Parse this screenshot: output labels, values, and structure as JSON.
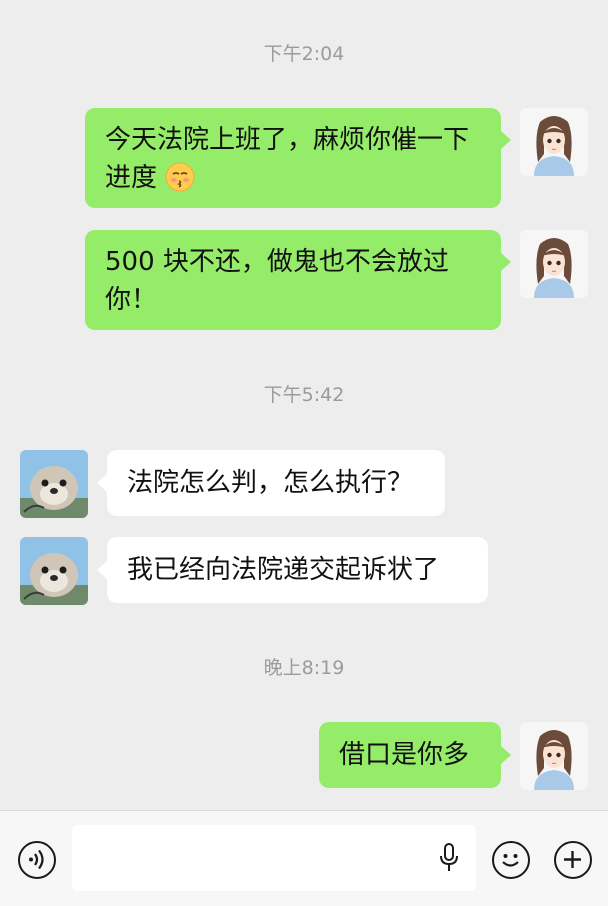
{
  "messages": {
    "ts1": "下午2:04",
    "m1": "今天法院上班了，麻烦你催一下进度",
    "m2": "500 块不还，做鬼也不会放过你！",
    "ts2": "下午5:42",
    "m3": "法院怎么判，怎么执行？",
    "m4": "我已经向法院递交起诉状了",
    "ts3": "晚上8:19",
    "m5": "借口是你多"
  },
  "input_bar": {
    "voice_icon": "voice-icon",
    "mic_icon": "microphone-icon",
    "emoji_icon": "emoji-icon",
    "plus_icon": "plus-icon",
    "input_value": ""
  },
  "colors": {
    "my_bubble": "#95ec69",
    "their_bubble": "#ffffff",
    "background": "#ededed"
  }
}
